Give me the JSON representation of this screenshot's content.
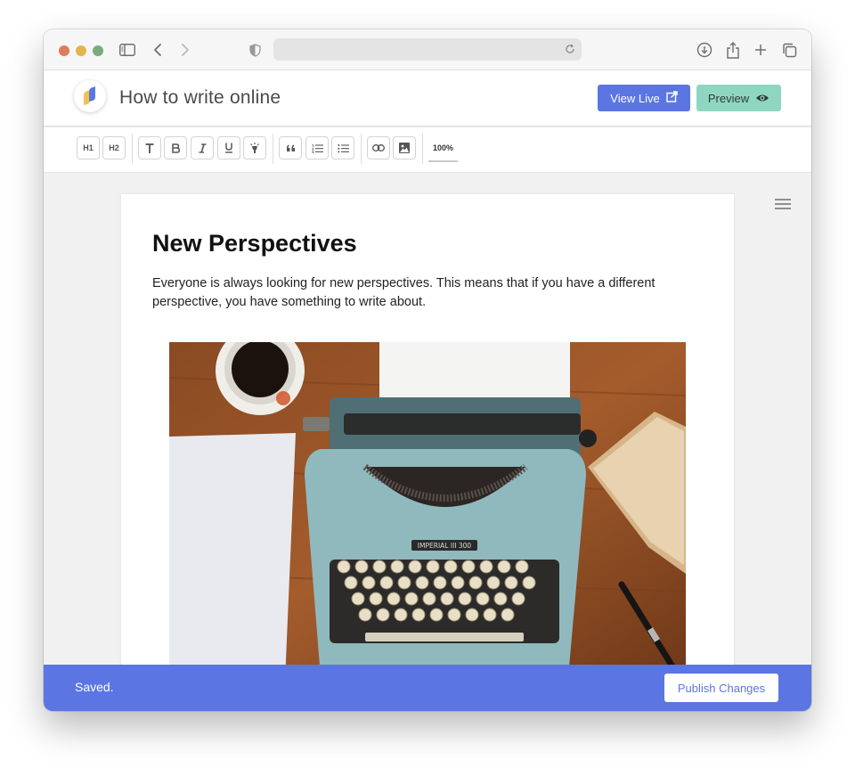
{
  "colors": {
    "accent": "#5b76e2",
    "preview": "#8fd6c0",
    "footer": "#5b76e2"
  },
  "browser": {
    "icons": [
      "sidebar-icon",
      "back-icon",
      "forward-icon",
      "shield-icon",
      "reload-icon",
      "download-icon",
      "share-icon",
      "new-tab-icon",
      "tabs-overview-icon"
    ]
  },
  "header": {
    "title": "How to write online",
    "view_live_label": "View Live",
    "preview_label": "Preview"
  },
  "format_toolbar": {
    "buttons": [
      {
        "label": "H1",
        "name": "heading1-button"
      },
      {
        "label": "H2",
        "name": "heading2-button"
      },
      {
        "label": "",
        "name": "text-icon"
      },
      {
        "label": "",
        "name": "bold-icon"
      },
      {
        "label": "",
        "name": "italic-icon"
      },
      {
        "label": "",
        "name": "underline-icon"
      },
      {
        "label": "",
        "name": "highlight-icon"
      },
      {
        "label": "",
        "name": "quote-icon"
      },
      {
        "label": "",
        "name": "ordered-list-icon"
      },
      {
        "label": "",
        "name": "bullet-list-icon"
      },
      {
        "label": "",
        "name": "link-icon"
      },
      {
        "label": "",
        "name": "image-icon"
      }
    ],
    "zoom": "100%"
  },
  "post": {
    "title": "New Perspectives",
    "body": "Everyone is always looking for new perspectives. This means that if you have a different perspective, you have something to write about.",
    "image_brand": "IMPERIAL III 300"
  },
  "footer": {
    "status": "Saved.",
    "publish_label": "Publish Changes"
  }
}
